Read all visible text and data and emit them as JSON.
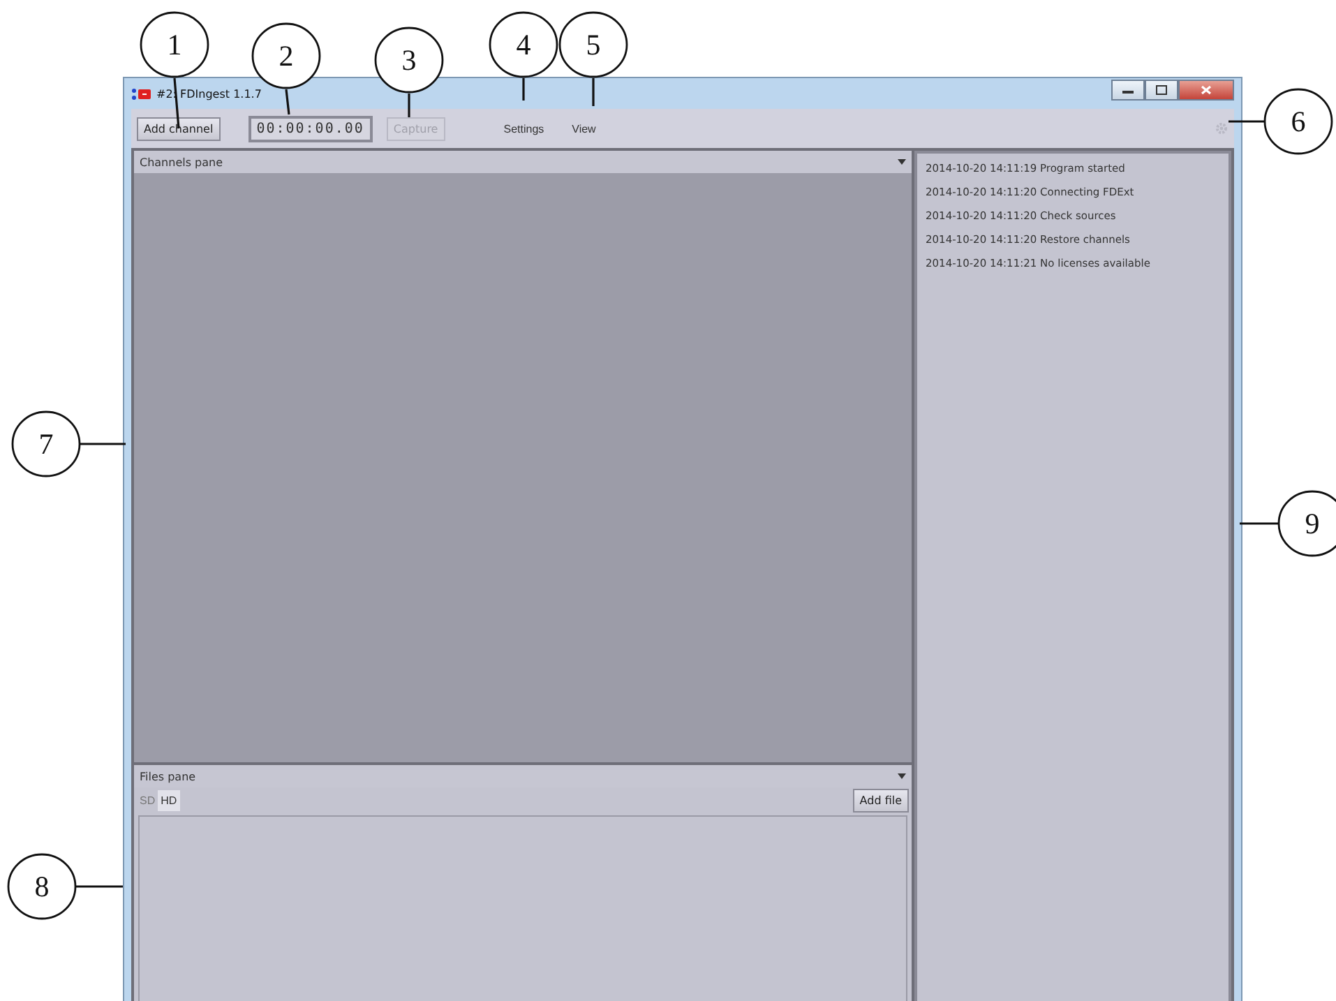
{
  "window": {
    "title": "#2: FDIngest 1.1.7"
  },
  "toolbar": {
    "add_channel": "Add channel",
    "timecode": "00:00:00.00",
    "capture": {
      "label": "Capture",
      "disabled": true
    },
    "settings": "Settings",
    "view": "View"
  },
  "channels_pane": {
    "title": "Channels pane"
  },
  "files_pane": {
    "title": "Files pane",
    "tabs": [
      {
        "label": "SD",
        "selected": false
      },
      {
        "label": "HD",
        "selected": true
      }
    ],
    "add_file": "Add file"
  },
  "log": [
    "2014-10-20 14:11:19  Program started",
    "2014-10-20 14:11:20  Connecting FDExt",
    "2014-10-20 14:11:20  Check sources",
    "2014-10-20 14:11:20  Restore channels",
    "2014-10-20 14:11:21  No licenses available"
  ],
  "callouts": [
    "1",
    "2",
    "3",
    "4",
    "5",
    "6",
    "7",
    "8",
    "9"
  ]
}
